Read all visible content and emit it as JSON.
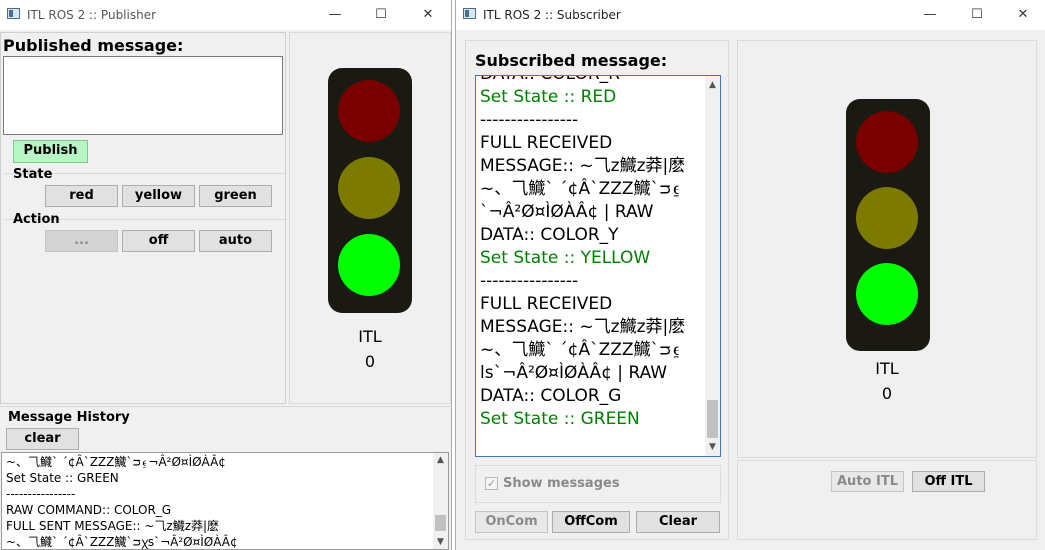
{
  "publisher": {
    "title": "ITL ROS 2 :: Publisher",
    "published_label": "Published message:",
    "publish_button": "Publish",
    "state_label": "State",
    "state_buttons": [
      "red",
      "yellow",
      "green"
    ],
    "action_label": "Action",
    "action_buttons": [
      "...",
      "off",
      "auto"
    ],
    "light_name": "ITL",
    "light_count": "0",
    "history_label": "Message History",
    "clear_button": "clear",
    "history_lines": [
      "~、⺄鱵` ´¢Â`ZZZ鱵`ᴝ⍷¬Â²Ø¤ÌØÀÂ¢",
      "Set State :: GREEN",
      "----------------",
      "RAW COMMAND:: COLOR_G",
      "FULL SENT MESSAGE:: ~⺄z鱵z莽|麽",
      "~、⺄鱵` ´¢Â`ZZZ鱵`ᴝꭓs`¬Â²Ø¤ÌØÀÂ¢"
    ]
  },
  "subscriber": {
    "title": "ITL ROS 2 :: Subscriber",
    "subscribed_label": "Subscribed message:",
    "lines": [
      {
        "text": "DATA:: COLOR_R",
        "color": "black"
      },
      {
        "text": "Set State :: RED",
        "color": "green"
      },
      {
        "text": "----------------",
        "color": "black"
      },
      {
        "text": "FULL RECEIVED",
        "color": "black"
      },
      {
        "text": "MESSAGE:: ~⺄z鱵z莽|麽",
        "color": "black"
      },
      {
        "text": "~、⺄鱵` ´¢Â`ZZZ鱵`ᴝ⍷",
        "color": "black"
      },
      {
        "text": "`¬Â²Ø¤ÌØÀÂ¢ | RAW",
        "color": "black"
      },
      {
        "text": "DATA:: COLOR_Y",
        "color": "black"
      },
      {
        "text": "Set State :: YELLOW",
        "color": "green"
      },
      {
        "text": "----------------",
        "color": "black"
      },
      {
        "text": "FULL RECEIVED",
        "color": "black"
      },
      {
        "text": "MESSAGE:: ~⺄z鱵z莽|麽",
        "color": "black"
      },
      {
        "text": "~、⺄鱵` ´¢Â`ZZZ鱵`ᴝ⍷",
        "color": "black"
      },
      {
        "text": "ls`¬Â²Ø¤ÌØÀÂ¢ | RAW",
        "color": "black"
      },
      {
        "text": "DATA:: COLOR_G",
        "color": "black"
      },
      {
        "text": "Set State :: GREEN",
        "color": "green"
      }
    ],
    "show_messages_label": "Show messages",
    "show_messages_checked": true,
    "oncom_button": "OnCom",
    "offcom_button": "OffCom",
    "clear_button": "Clear",
    "light_name": "ITL",
    "light_count": "0",
    "auto_itl_button": "Auto ITL",
    "off_itl_button": "Off ITL"
  },
  "colors": {
    "lamp_red": "#7a0000",
    "lamp_yellow": "#7d7a00",
    "lamp_green": "#00ff00",
    "light_body": "#1a1a12",
    "text_green": "#008000",
    "publish_button_bg": "#b7f5c4"
  },
  "icons": {
    "window": "app-window-icon",
    "minimize": "minimize-icon",
    "maximize": "maximize-icon",
    "close": "close-icon",
    "checkbox": "check-icon"
  }
}
